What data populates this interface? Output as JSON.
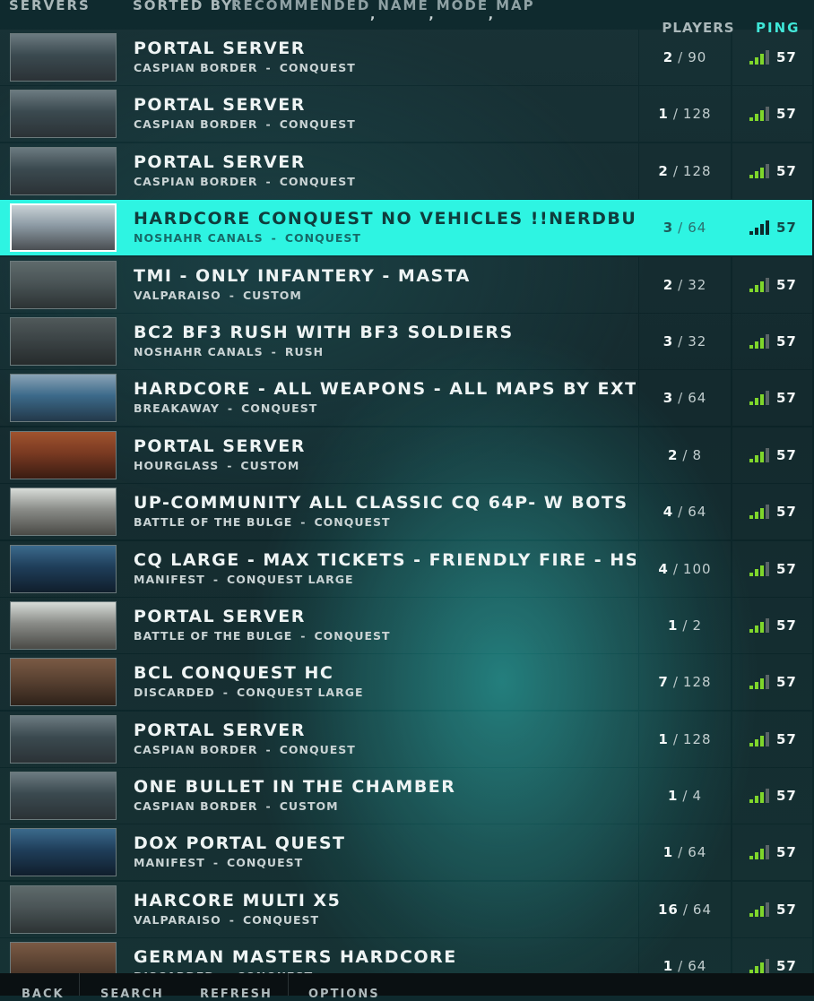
{
  "header": {
    "servers_label": "SERVERS",
    "sorted_by_label": "SORTED BY:",
    "sort_options": [
      "RECOMMENDED",
      "NAME",
      "MODE",
      "MAP"
    ],
    "players_label": "PLAYERS",
    "ping_label": "PING"
  },
  "colors": {
    "accent": "#2ef4e2",
    "signal_on": "#7fd62b",
    "signal_off": "#5a6466"
  },
  "servers": [
    {
      "name": "PORTAL SERVER",
      "map": "CASPIAN BORDER",
      "mode": "CONQUEST",
      "players": "2",
      "max": "90",
      "ping": "57",
      "signal": 3,
      "thumb": [
        "#3b4a50",
        "#6b7a80",
        "#2b3236"
      ]
    },
    {
      "name": "PORTAL SERVER",
      "map": "CASPIAN BORDER",
      "mode": "CONQUEST",
      "players": "1",
      "max": "128",
      "ping": "57",
      "signal": 3,
      "thumb": [
        "#3b4a50",
        "#6b7a80",
        "#2b3236"
      ]
    },
    {
      "name": "PORTAL SERVER",
      "map": "CASPIAN BORDER",
      "mode": "CONQUEST",
      "players": "2",
      "max": "128",
      "ping": "57",
      "signal": 3,
      "thumb": [
        "#3b4a50",
        "#6b7a80",
        "#2b3236"
      ]
    },
    {
      "name": "HARDCORE CONQUEST NO VEHICLES !!NERDBUMMER SER",
      "map": "NOSHAHR CANALS",
      "mode": "CONQUEST",
      "players": "3",
      "max": "64",
      "ping": "57",
      "signal": 4,
      "selected": true,
      "thumb": [
        "#8c9aa4",
        "#c9d2d6",
        "#4a4e52"
      ]
    },
    {
      "name": "TMI - ONLY INFANTERY - MASTA",
      "map": "VALPARAISO",
      "mode": "CUSTOM",
      "players": "2",
      "max": "32",
      "ping": "57",
      "signal": 3,
      "thumb": [
        "#4a5456",
        "#5e6a6b",
        "#2c3334"
      ]
    },
    {
      "name": "BC2 BF3 RUSH WITH BF3 SOLDIERS",
      "map": "NOSHAHR CANALS",
      "mode": "RUSH",
      "players": "3",
      "max": "32",
      "ping": "57",
      "signal": 3,
      "thumb": [
        "#3c4446",
        "#50595a",
        "#262b2c"
      ]
    },
    {
      "name": "HARDCORE - ALL WEAPONS - ALL MAPS BY EXTREMEHRZ",
      "map": "BREAKAWAY",
      "mode": "CONQUEST",
      "players": "3",
      "max": "64",
      "ping": "57",
      "signal": 3,
      "thumb": [
        "#3c6a8a",
        "#8aa3b6",
        "#23394a"
      ]
    },
    {
      "name": "PORTAL SERVER",
      "map": "HOURGLASS",
      "mode": "CUSTOM",
      "players": "2",
      "max": "8",
      "ping": "57",
      "signal": 3,
      "thumb": [
        "#7a3a22",
        "#a0532e",
        "#3a1c12"
      ]
    },
    {
      "name": "UP-COMMUNITY ALL CLASSIC CQ 64P- W BOTS",
      "map": "BATTLE OF THE BULGE",
      "mode": "CONQUEST",
      "players": "4",
      "max": "64",
      "ping": "57",
      "signal": 3,
      "thumb": [
        "#8a8c88",
        "#d8dcd8",
        "#4a4a46"
      ]
    },
    {
      "name": "CQ LARGE - MAX TICKETS - FRIENDLY FIRE - HS MULTIPLIE",
      "map": "MANIFEST",
      "mode": "CONQUEST LARGE",
      "players": "4",
      "max": "100",
      "ping": "57",
      "signal": 3,
      "thumb": [
        "#1f3e5a",
        "#3b6a8c",
        "#101e2c"
      ]
    },
    {
      "name": "PORTAL SERVER",
      "map": "BATTLE OF THE BULGE",
      "mode": "CONQUEST",
      "players": "1",
      "max": "2",
      "ping": "57",
      "signal": 3,
      "thumb": [
        "#8a8c88",
        "#d8dcd8",
        "#4a4a46"
      ]
    },
    {
      "name": "BCL CONQUEST HC",
      "map": "DISCARDED",
      "mode": "CONQUEST LARGE",
      "players": "7",
      "max": "128",
      "ping": "57",
      "signal": 3,
      "thumb": [
        "#5a4232",
        "#7a5a44",
        "#2e221a"
      ]
    },
    {
      "name": "PORTAL SERVER",
      "map": "CASPIAN BORDER",
      "mode": "CONQUEST",
      "players": "1",
      "max": "128",
      "ping": "57",
      "signal": 3,
      "thumb": [
        "#3b4a50",
        "#6b7a80",
        "#2b3236"
      ]
    },
    {
      "name": "ONE BULLET IN THE CHAMBER",
      "map": "CASPIAN BORDER",
      "mode": "CUSTOM",
      "players": "1",
      "max": "4",
      "ping": "57",
      "signal": 3,
      "thumb": [
        "#3b4a50",
        "#6b7a80",
        "#2b3236"
      ]
    },
    {
      "name": "DOX PORTAL QUEST",
      "map": "MANIFEST",
      "mode": "CONQUEST",
      "players": "1",
      "max": "64",
      "ping": "57",
      "signal": 3,
      "thumb": [
        "#1f3e5a",
        "#3b6a8c",
        "#101e2c"
      ]
    },
    {
      "name": "HARCORE MULTI X5",
      "map": "VALPARAISO",
      "mode": "CONQUEST",
      "players": "16",
      "max": "64",
      "ping": "57",
      "signal": 3,
      "thumb": [
        "#4a5456",
        "#5e6a6b",
        "#2c3334"
      ]
    },
    {
      "name": "GERMAN MASTERS HARDCORE",
      "map": "DISCARDED",
      "mode": "CONQUEST",
      "players": "1",
      "max": "64",
      "ping": "57",
      "signal": 3,
      "thumb": [
        "#5a4232",
        "#7a5a44",
        "#2e221a"
      ]
    }
  ],
  "footer": {
    "back": "BACK",
    "search": "SEARCH",
    "refresh": "REFRESH",
    "options": "OPTIONS"
  }
}
